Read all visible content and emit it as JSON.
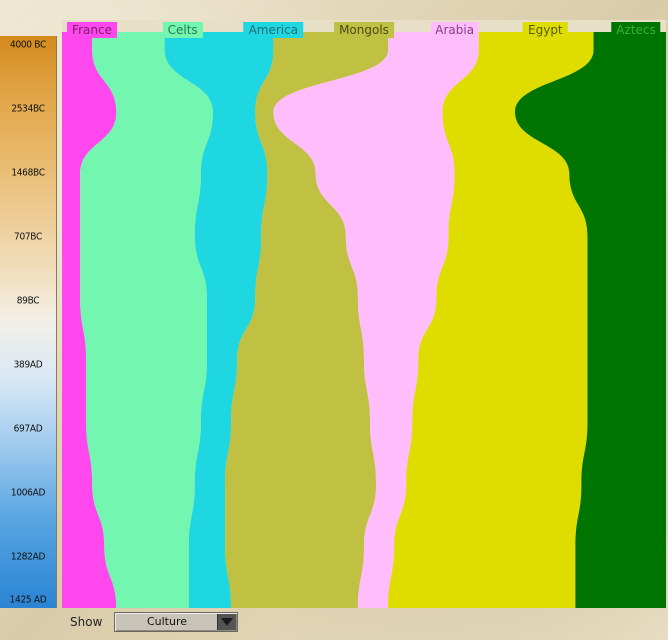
{
  "timeline": {
    "ticks": [
      "4000 BC",
      "2534BC",
      "1468BC",
      "707BC",
      "89BC",
      "389AD",
      "697AD",
      "1006AD",
      "1282AD",
      "1425 AD"
    ]
  },
  "chart_data": {
    "type": "area",
    "series": [
      {
        "name": "France",
        "color": "#ff47ee",
        "values": [
          5,
          9,
          3,
          3,
          3,
          4,
          4,
          5,
          7,
          9
        ]
      },
      {
        "name": "Celts",
        "color": "#73f7b0",
        "values": [
          12,
          16,
          20,
          19,
          21,
          20,
          19,
          17,
          14,
          12
        ]
      },
      {
        "name": "America",
        "color": "#1fd7e0",
        "values": [
          18,
          7,
          11,
          11,
          8,
          5,
          5,
          5,
          6,
          7
        ]
      },
      {
        "name": "Mongols",
        "color": "#c0c143",
        "values": [
          19,
          3,
          8,
          14,
          17,
          21,
          23,
          25,
          23,
          21
        ]
      },
      {
        "name": "Arabia",
        "color": "#ffbdfb",
        "values": [
          15,
          28,
          23,
          17,
          13,
          9,
          7,
          5,
          5,
          5
        ]
      },
      {
        "name": "Egypt",
        "color": "#dfdd00",
        "values": [
          19,
          12,
          19,
          23,
          25,
          28,
          29,
          29,
          30,
          31
        ]
      },
      {
        "name": "Aztecs",
        "color": "#007400",
        "values": [
          12,
          25,
          16,
          13,
          13,
          13,
          13,
          14,
          15,
          15
        ]
      }
    ]
  },
  "controls": {
    "show_label": "Show",
    "show_value": "Culture"
  }
}
